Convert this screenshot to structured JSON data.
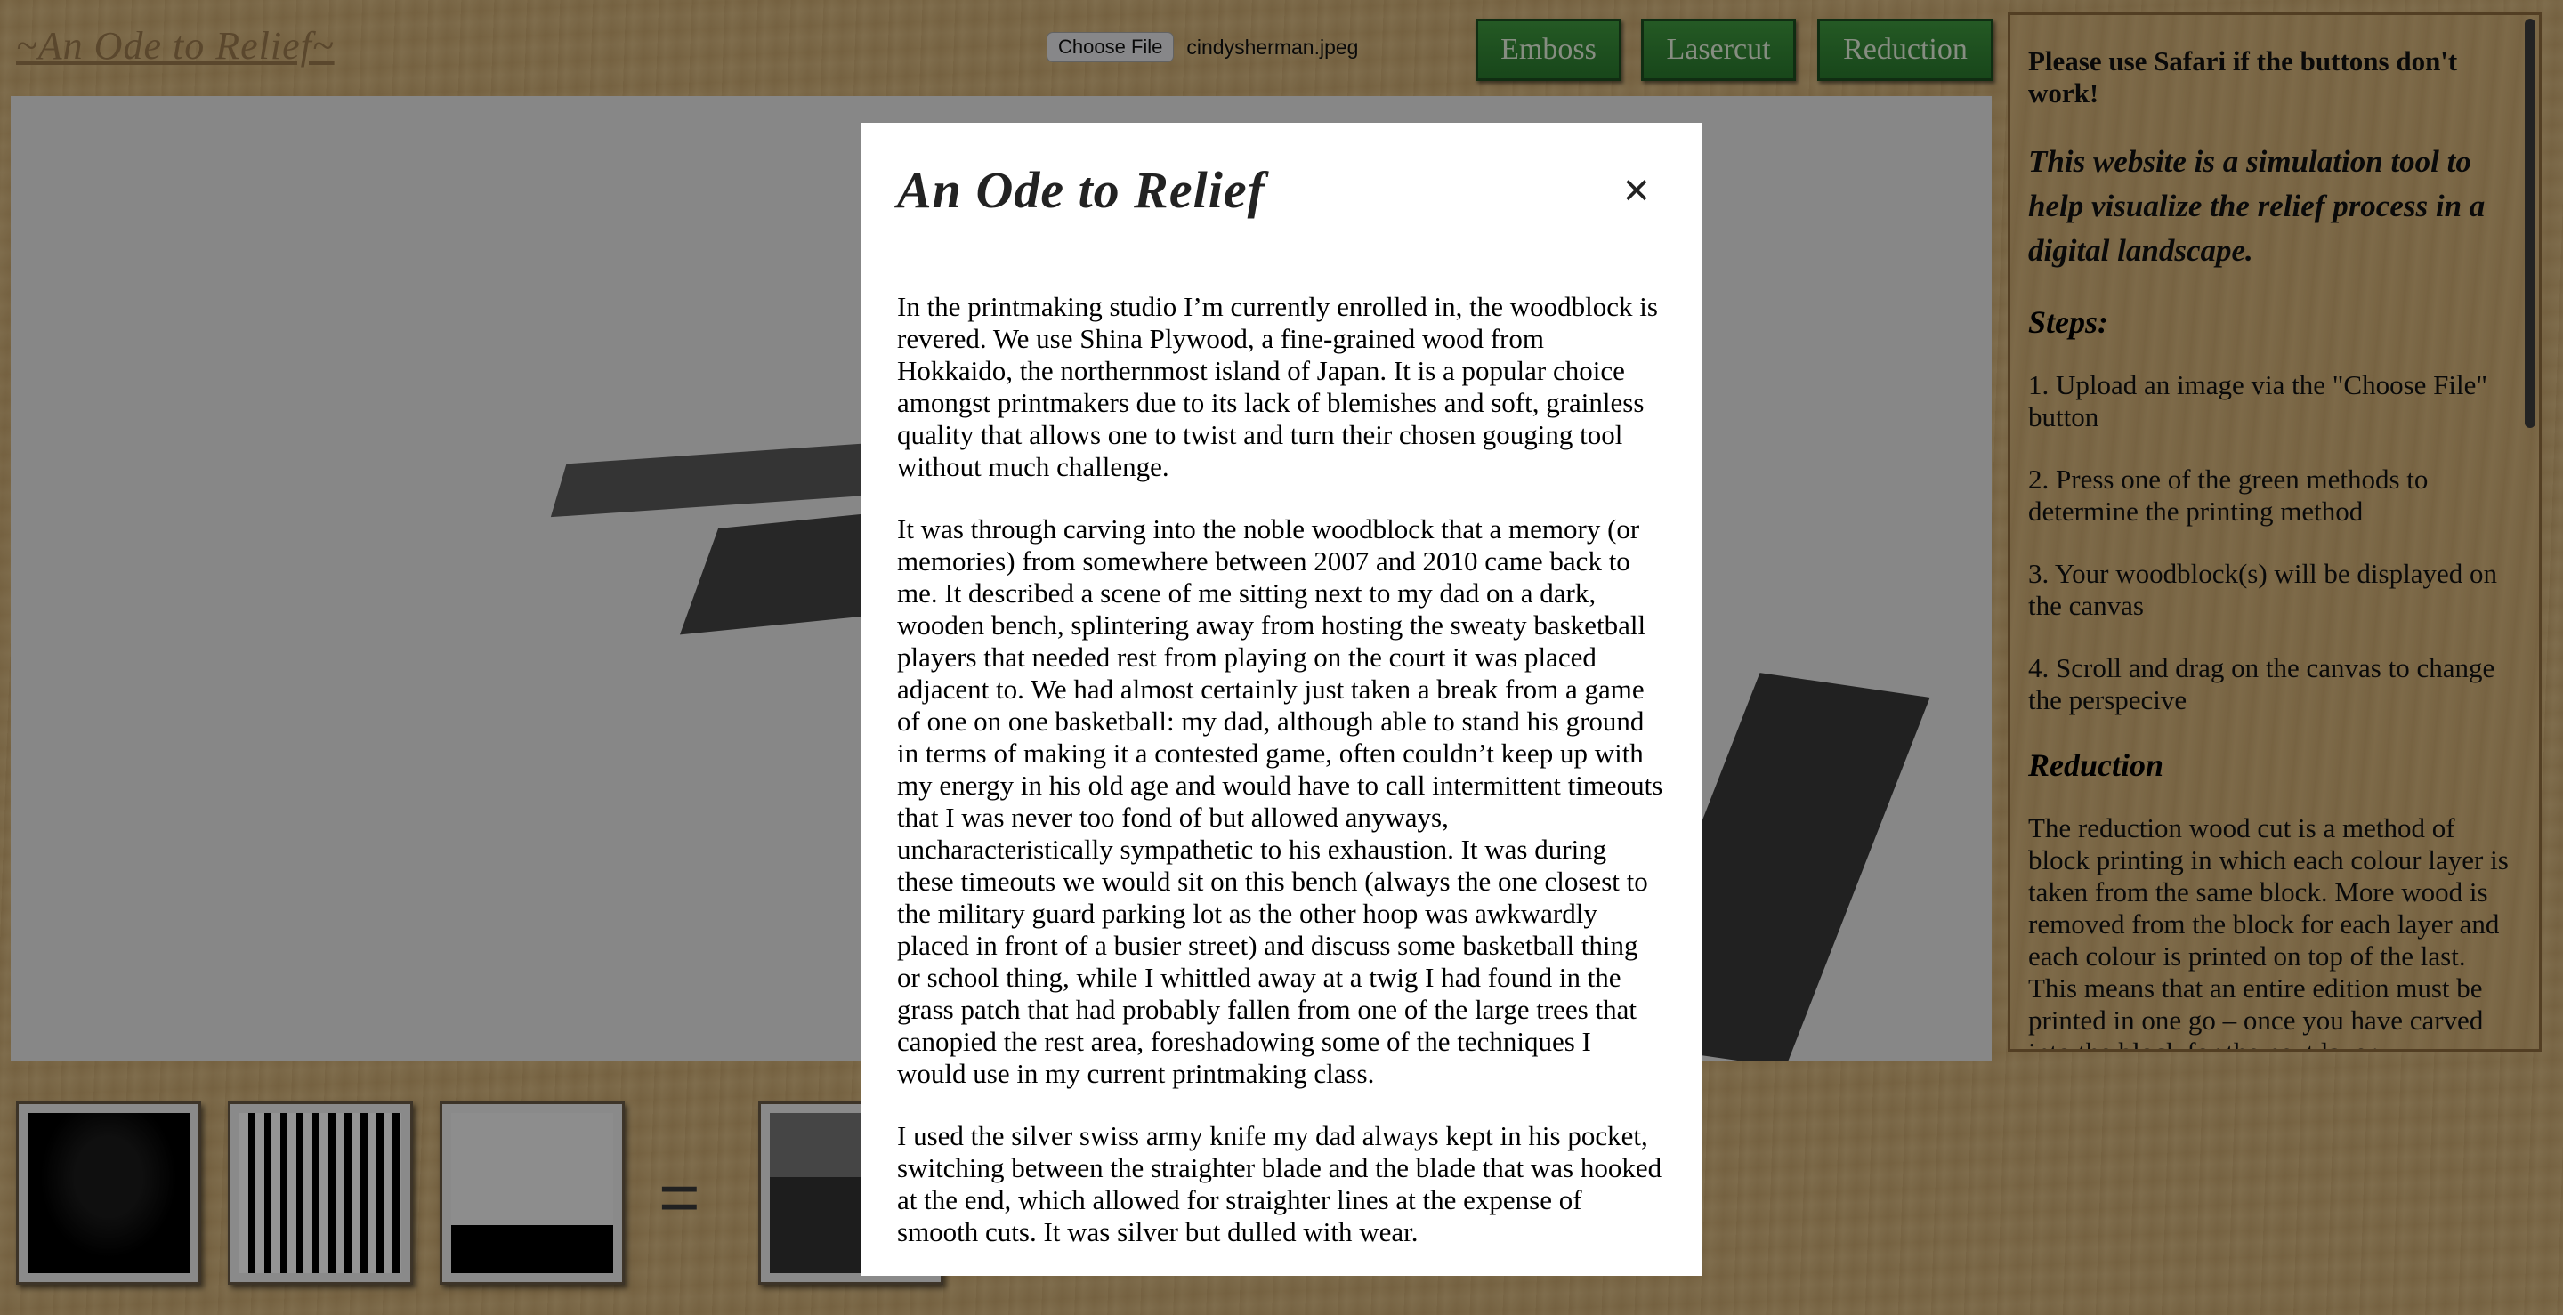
{
  "header": {
    "title": "~An Ode to Relief~",
    "choose_file_label": "Choose File",
    "file_name": "cindysherman.jpeg",
    "buttons": [
      "Emboss",
      "Lasercut",
      "Reduction"
    ]
  },
  "side_panel": {
    "safari_note": "Please use Safari if the buttons don't work!",
    "intro": "This website is a simulation tool to help visualize the relief process in a digital landscape.",
    "steps_heading": "Steps:",
    "steps": [
      "1. Upload an image via the \"Choose File\" button",
      "2. Press one of the green methods to determine the printing method",
      "3. Your woodblock(s) will be displayed on the canvas",
      "4. Scroll and drag on the canvas to change the perspecive"
    ],
    "reduction_heading": "Reduction",
    "reduction_text": "The reduction wood cut is a method of block printing in which each colour layer is taken from the same block. More wood is removed from the block for each layer and each colour is printed on top of the last. This means that an entire edition must be printed in one go – once you have carved into the block for the next layer"
  },
  "thumbnails": {
    "equals_sign": "="
  },
  "modal": {
    "title": "An Ode to Relief",
    "close_label": "×",
    "paragraphs": [
      "In the printmaking studio I’m currently enrolled in, the woodblock is revered. We use Shina Plywood, a fine-grained wood from Hokkaido, the northernmost island of Japan. It is a popular choice amongst printmakers due to its lack of blemishes and soft, grainless quality that allows one to twist and turn their chosen gouging tool without much challenge.",
      "It was through carving into the noble woodblock that a memory (or memories) from somewhere between 2007 and 2010 came back to me. It described a scene of me sitting next to my dad on a dark, wooden bench, splintering away from hosting the sweaty basketball players that needed rest from playing on the court it was placed adjacent to. We had almost certainly just taken a break from a game of one on one basketball: my dad, although able to stand his ground in terms of making it a contested game, often couldn’t keep up with my energy in his old age and would have to call intermittent timeouts that I was never too fond of but allowed anyways, uncharacteristically sympathetic to his exhaustion. It was during these timeouts we would sit on this bench (always the one closest to the military guard parking lot as the other hoop was awkwardly placed in front of a busier street) and discuss some basketball thing or school thing, while I whittled away at a twig I had found in the grass patch that had probably fallen from one of the large trees that canopied the rest area, foreshadowing some of the techniques I would use in my current printmaking class.",
      "I used the silver swiss army knife my dad always kept in his pocket, switching between the straighter blade and the blade that was hooked at the end, which allowed for straighter lines at the expense of smooth cuts. It was silver but dulled with wear."
    ]
  },
  "colors": {
    "wood": "#d8b77d",
    "button_green": "#3f9a3f",
    "overlay": "rgba(0,0,0,0.42)"
  }
}
